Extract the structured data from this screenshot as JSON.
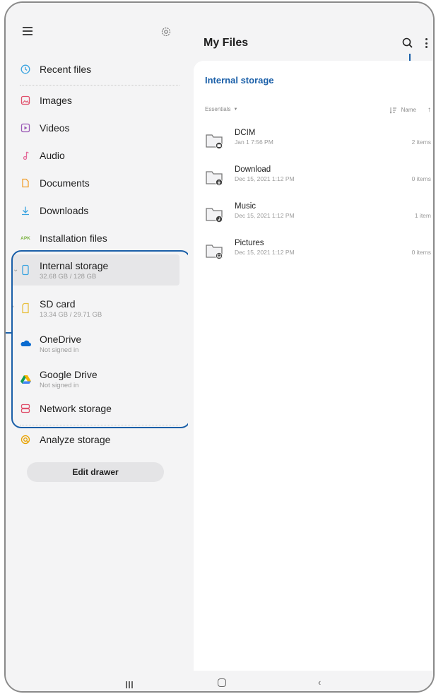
{
  "drawer": {
    "recent_label": "Recent files",
    "categories": [
      {
        "label": "Images",
        "icon": "image-icon"
      },
      {
        "label": "Videos",
        "icon": "video-icon"
      },
      {
        "label": "Audio",
        "icon": "audio-icon"
      },
      {
        "label": "Documents",
        "icon": "document-icon"
      },
      {
        "label": "Downloads",
        "icon": "download-icon"
      },
      {
        "label": "Installation files",
        "icon": "apk-icon",
        "icon_text": "APK"
      }
    ],
    "storage": [
      {
        "label": "Internal storage",
        "sub": "32.68 GB / 128 GB",
        "icon": "phone-icon"
      },
      {
        "label": "SD card",
        "sub": "13.34 GB / 29.71 GB",
        "icon": "sd-card-icon"
      },
      {
        "label": "OneDrive",
        "sub": "Not signed in",
        "icon": "onedrive-icon"
      },
      {
        "label": "Google Drive",
        "sub": "Not signed in",
        "icon": "google-drive-icon"
      },
      {
        "label": "Network storage",
        "icon": "network-storage-icon"
      }
    ],
    "analyze_label": "Analyze storage",
    "edit_drawer_label": "Edit drawer"
  },
  "main": {
    "title": "My Files",
    "location": "Internal storage",
    "filter_label": "Essentials",
    "sort_label": "Name",
    "folders": [
      {
        "name": "DCIM",
        "date": "Jan 1 7:56 PM",
        "count": "2 items",
        "badge": "camera"
      },
      {
        "name": "Download",
        "date": "Dec 15, 2021 1:12 PM",
        "count": "0 items",
        "badge": "download"
      },
      {
        "name": "Music",
        "date": "Dec 15, 2021 1:12 PM",
        "count": "1 item",
        "badge": "music"
      },
      {
        "name": "Pictures",
        "date": "Dec 15, 2021 1:12 PM",
        "count": "0 items",
        "badge": "picture"
      }
    ]
  },
  "colors": {
    "accent": "#1a5fa8",
    "images": "#e0506b",
    "videos": "#9b59b6",
    "audio": "#e56b9a",
    "documents": "#f0a030",
    "downloads": "#3ba4e0",
    "apk": "#7cb342",
    "analyze": "#e8a200"
  }
}
